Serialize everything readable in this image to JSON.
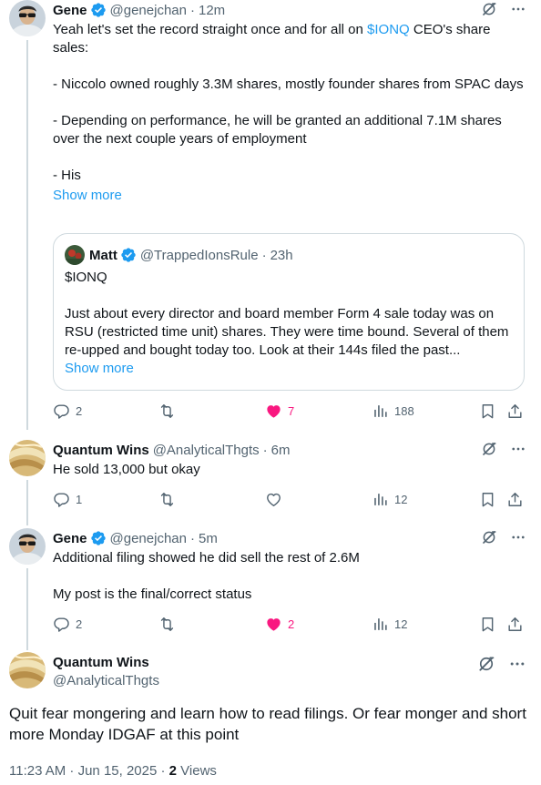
{
  "colors": {
    "link": "#1d9bf0",
    "muted": "#536471",
    "like": "#f91880",
    "border": "#cfd9de",
    "verified": "#1d9bf0"
  },
  "posts": [
    {
      "name": "Gene",
      "handle": "@genejchan",
      "time": "12m",
      "lines": [
        "Yeah let's set the record straight once and for all on ",
        "- Niccolo owned roughly 3.3M shares, mostly founder shares from SPAC days",
        "- Depending on performance, he will be granted an additional 7.1M shares over the next couple years of employment",
        "- His"
      ],
      "cashtag": "$IONQ",
      "after_cashtag": " CEO's share sales:",
      "show_more": "Show more",
      "quote": {
        "name": "Matt",
        "handle": "@TrappedIonsRule",
        "time": "23h",
        "cashtag": "$IONQ",
        "text": "Just about every director and board member Form 4 sale today was on RSU (restricted time unit) shares. They were time bound. Several of them re-upped and bought today too. Look at their 144s filed the past...",
        "show_more": "Show more"
      },
      "replies": "2",
      "reposts": "",
      "likes": "7",
      "views": "188",
      "liked": true
    },
    {
      "name": "Quantum Wins",
      "handle": "@AnalyticalThgts",
      "time": "6m",
      "text": "He sold 13,000 but okay",
      "replies": "1",
      "likes": "",
      "views": "12",
      "liked": false
    },
    {
      "name": "Gene",
      "handle": "@genejchan",
      "time": "5m",
      "line1": "Additional filing showed he did sell the rest of 2.6M",
      "line2": "My post is the final/correct status",
      "replies": "2",
      "likes": "2",
      "views": "12",
      "liked": true
    }
  ],
  "detail": {
    "name": "Quantum Wins",
    "handle": "@AnalyticalThgts",
    "text": "Quit fear mongering and learn how to read filings.  Or fear monger and short more Monday IDGAF at this point",
    "timestamp": "11:23 AM · Jun 15, 2025 · ",
    "views_count": "2",
    "views_label": " Views"
  },
  "separator": "·"
}
